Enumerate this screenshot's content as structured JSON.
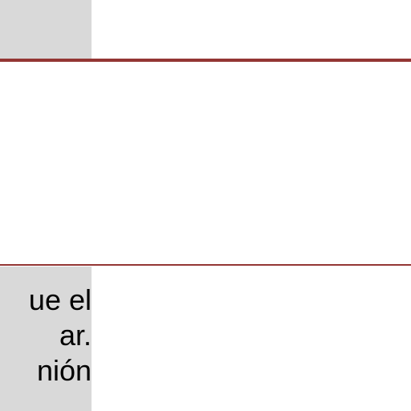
{
  "table": {
    "colors": {
      "accent_rule": "#943634",
      "shaded_cell": "#d9d9d9"
    },
    "rows": [
      {
        "left_cell": [],
        "right_cell": []
      },
      {
        "left_cell": [],
        "right_cell": []
      },
      {
        "left_cell": [
          "ue el",
          "ar.",
          "nión"
        ],
        "right_cell": []
      }
    ]
  }
}
